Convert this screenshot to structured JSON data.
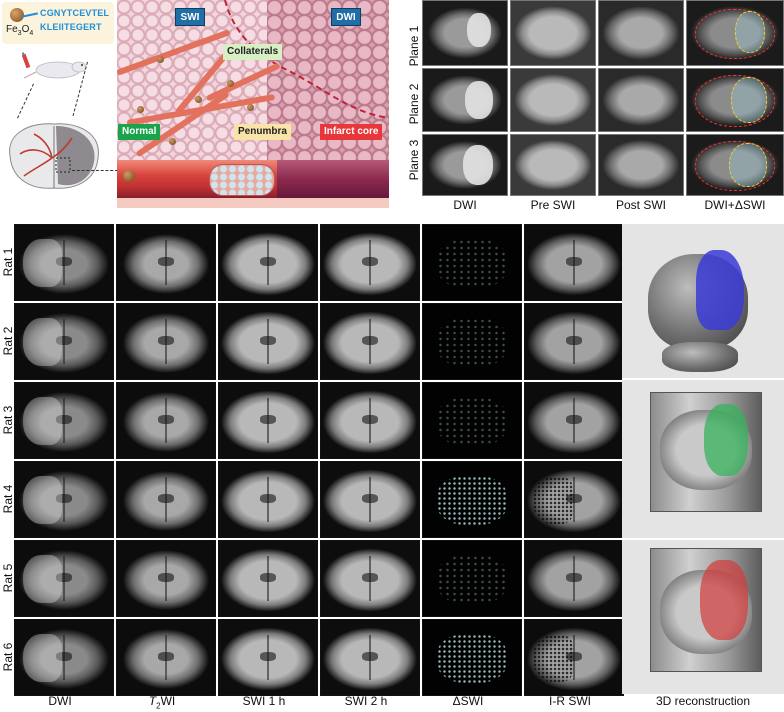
{
  "schematic": {
    "nanoparticle_label": "Fe3O4",
    "peptide_line1": "CGNYTCEVTEL",
    "peptide_line2": "KLEIITEGERT",
    "scanner_left": "SWI",
    "scanner_right": "DWI",
    "collaterals": "Collaterals",
    "normal": "Normal",
    "penumbra": "Penumbra",
    "infarct_core": "Infarct core",
    "colors": {
      "normal": "#19a34a",
      "penumbra": "#f7e4a6",
      "infarct_core": "#e8373a",
      "scanner": "#1f6fa6",
      "peptide": "#1e8fd8"
    }
  },
  "top_grid": {
    "rows": [
      "Plane 1",
      "Plane 2",
      "Plane 3"
    ],
    "columns": [
      "DWI",
      "Pre SWI",
      "Post SWI",
      "DWI+ΔSWI"
    ]
  },
  "bottom_grid": {
    "rows": [
      "Rat 1",
      "Rat 2",
      "Rat 3",
      "Rat 4",
      "Rat 5",
      "Rat 6"
    ],
    "columns": [
      "DWI",
      "T2WI",
      "SWI 1 h",
      "SWI 2 h",
      "ΔSWI",
      "I-R SWI",
      "3D reconstruction"
    ],
    "t2_base": "T",
    "t2_sub": "2",
    "t2_rest": "WI"
  },
  "reconstruction_colors": [
    "#3b3bd6",
    "#37b25a",
    "#d23a3a"
  ]
}
